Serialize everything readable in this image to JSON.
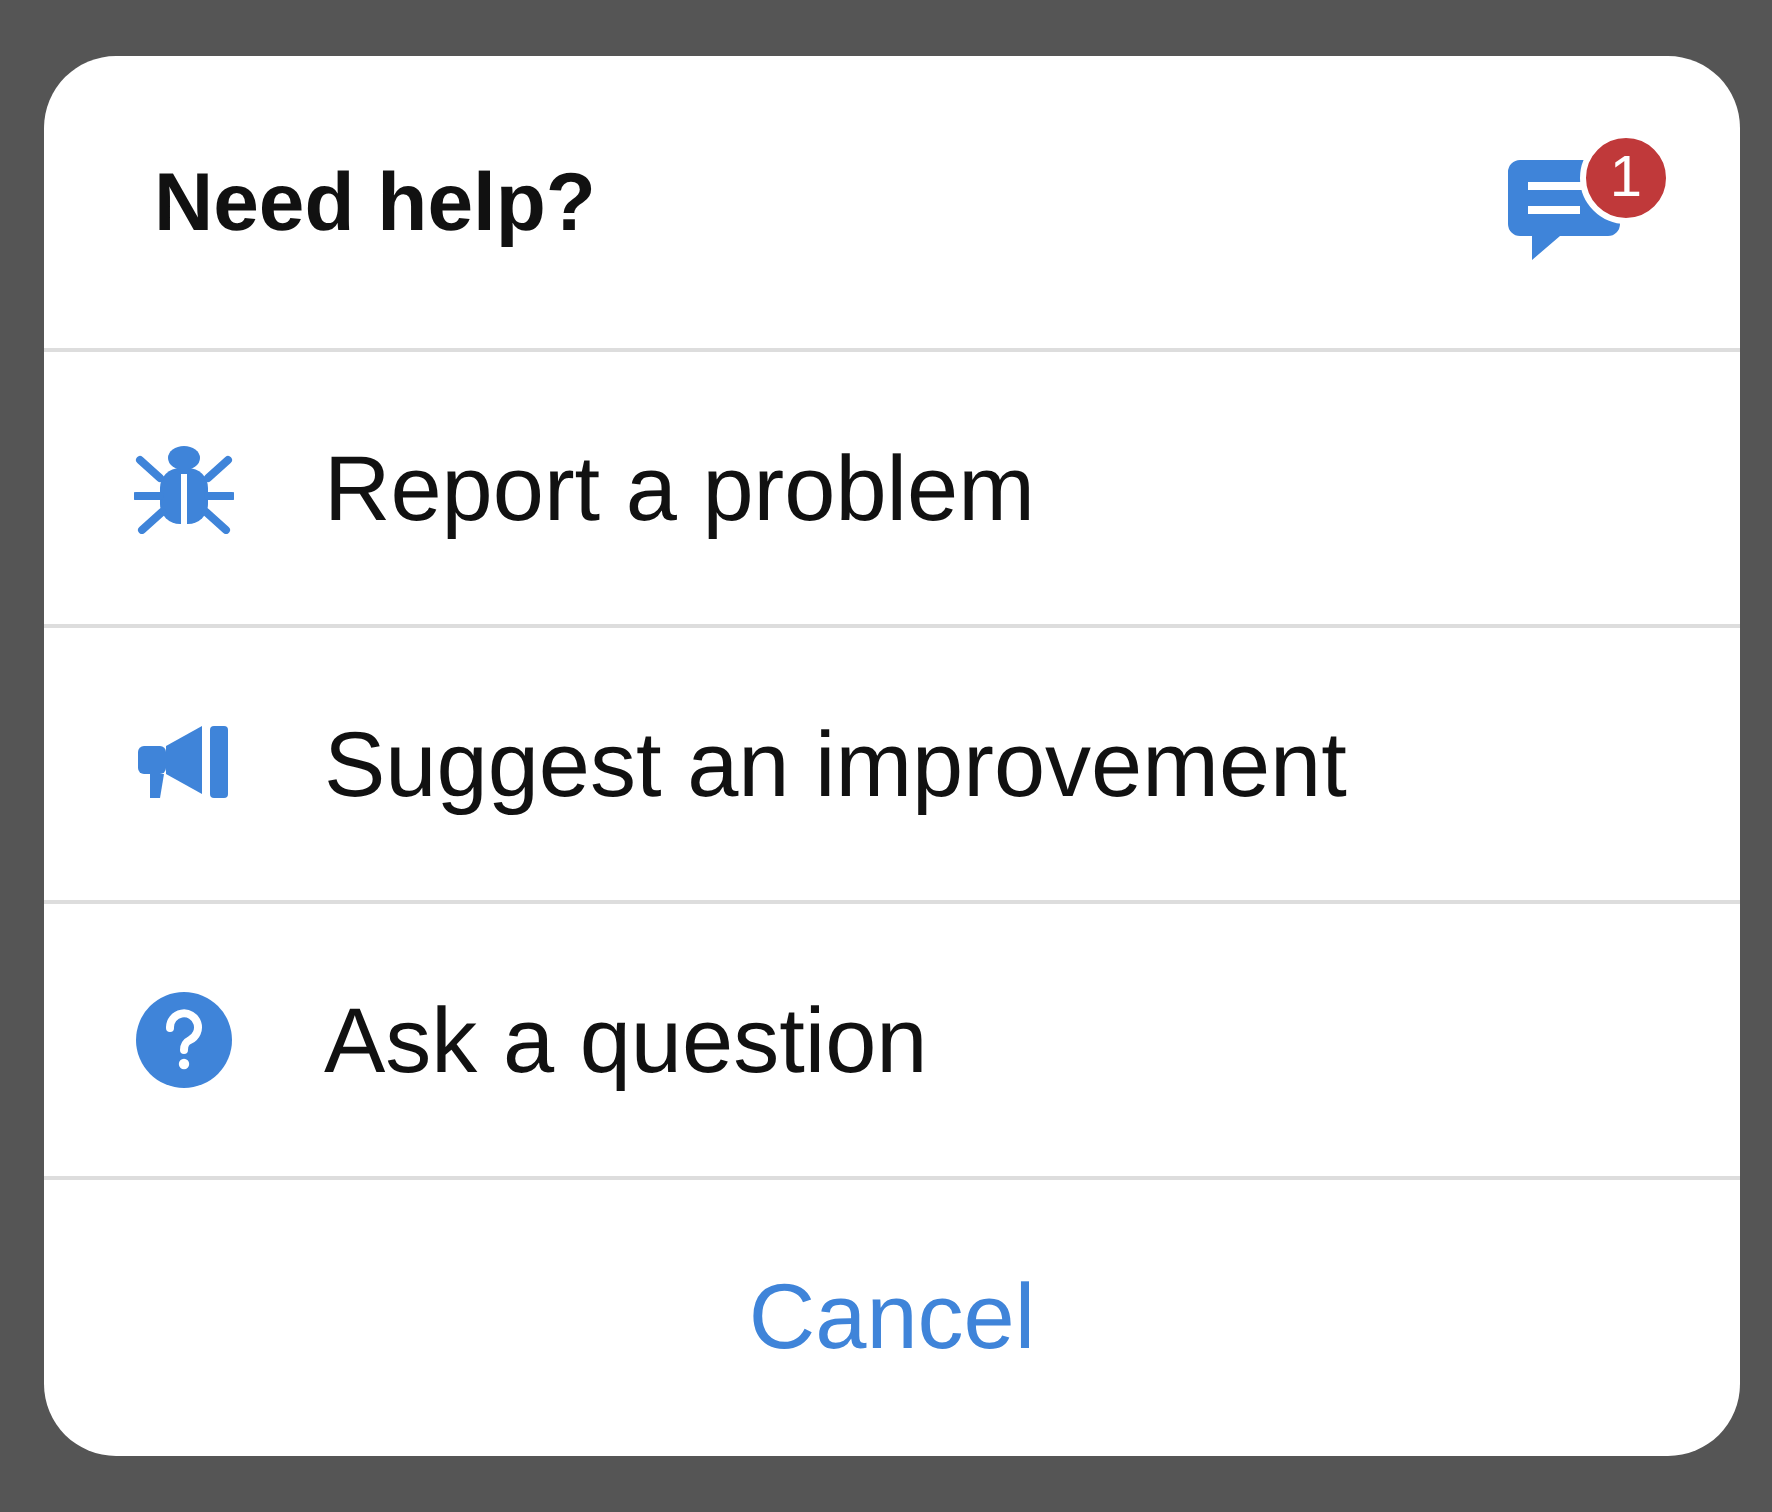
{
  "header": {
    "title": "Need help?",
    "badge": "1"
  },
  "items": [
    {
      "label": "Report a problem"
    },
    {
      "label": "Suggest an improvement"
    },
    {
      "label": "Ask a question"
    }
  ],
  "cancel": "Cancel"
}
